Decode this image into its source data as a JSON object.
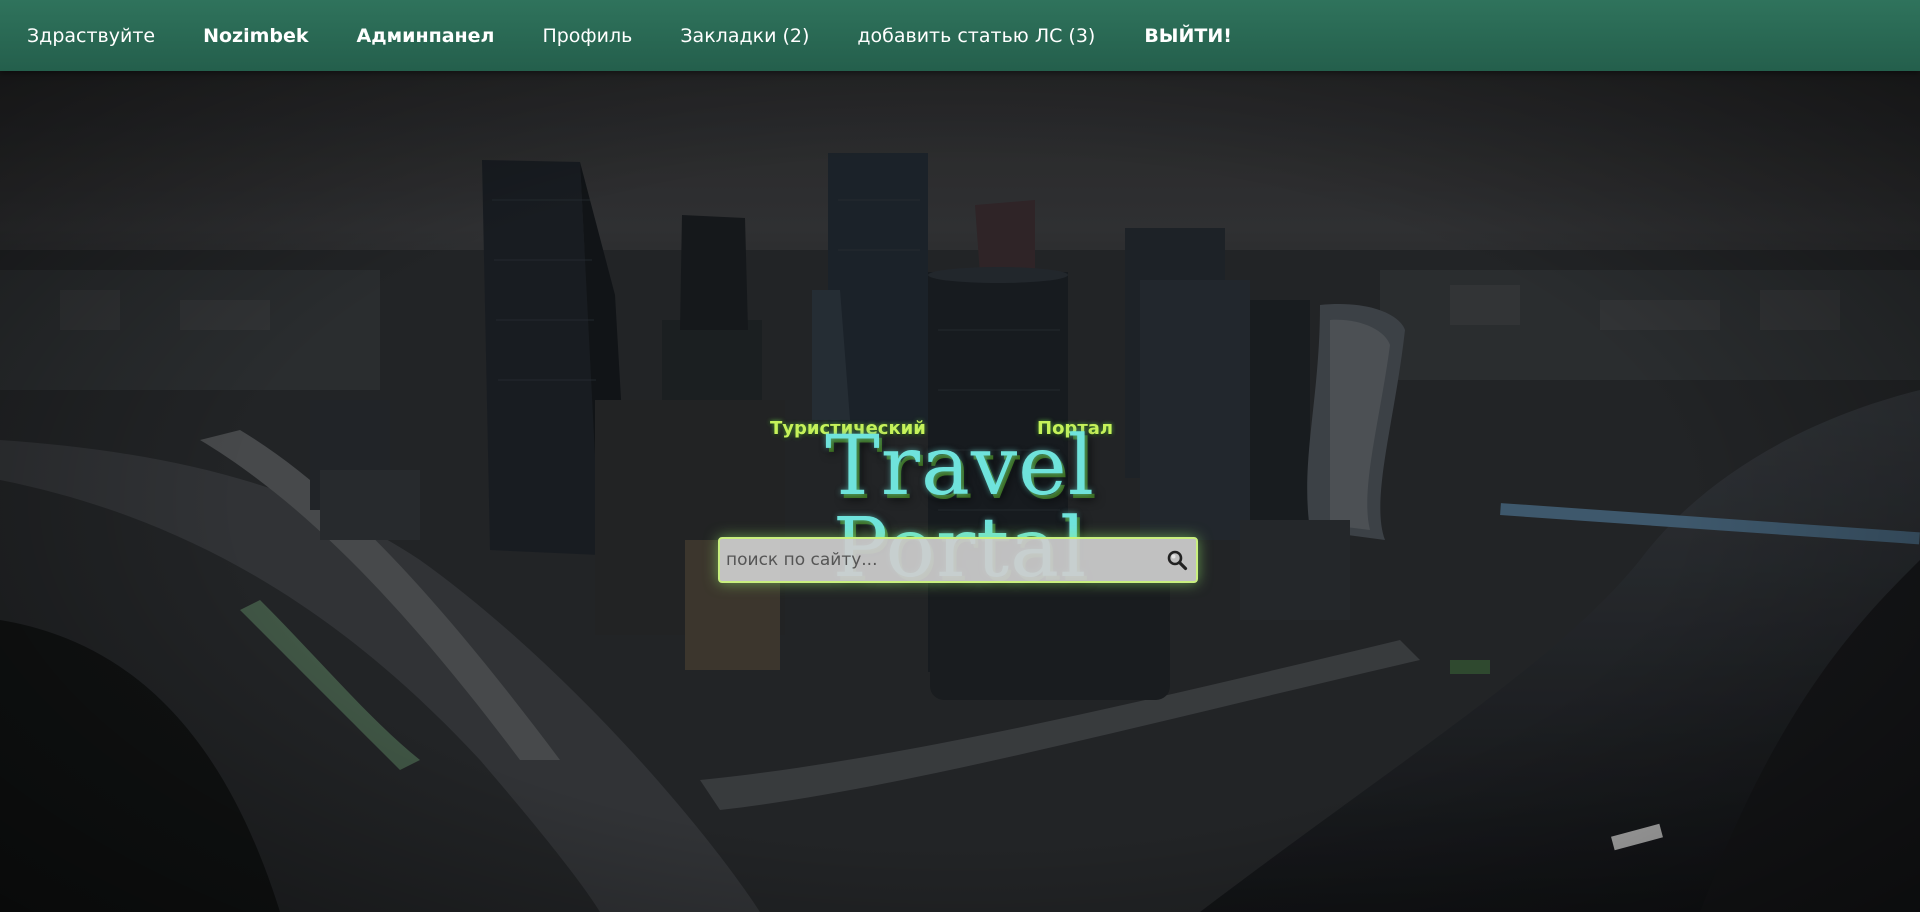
{
  "navbar": {
    "items": [
      {
        "label": "Здраствуйте",
        "bold": false
      },
      {
        "label": "Nozimbek",
        "bold": true
      },
      {
        "label": "Админпанел",
        "bold": true
      },
      {
        "label": "Профиль",
        "bold": false
      },
      {
        "label": "Закладки (2)",
        "bold": false
      },
      {
        "label": "добавить статью ЛС (3)",
        "bold": false
      }
    ],
    "logout_label": "ВЫЙТИ!"
  },
  "logo": {
    "sub_left": "Туристический",
    "sub_right": "Портал",
    "title": "Travel Portal"
  },
  "search": {
    "placeholder": "поиск по сайту...",
    "icon": "search-icon"
  },
  "colors": {
    "navbar": "#2f735c",
    "logo_text": "#6fe3dc",
    "logo_sub": "#c6f25a",
    "search_border": "#c9ef7f"
  }
}
